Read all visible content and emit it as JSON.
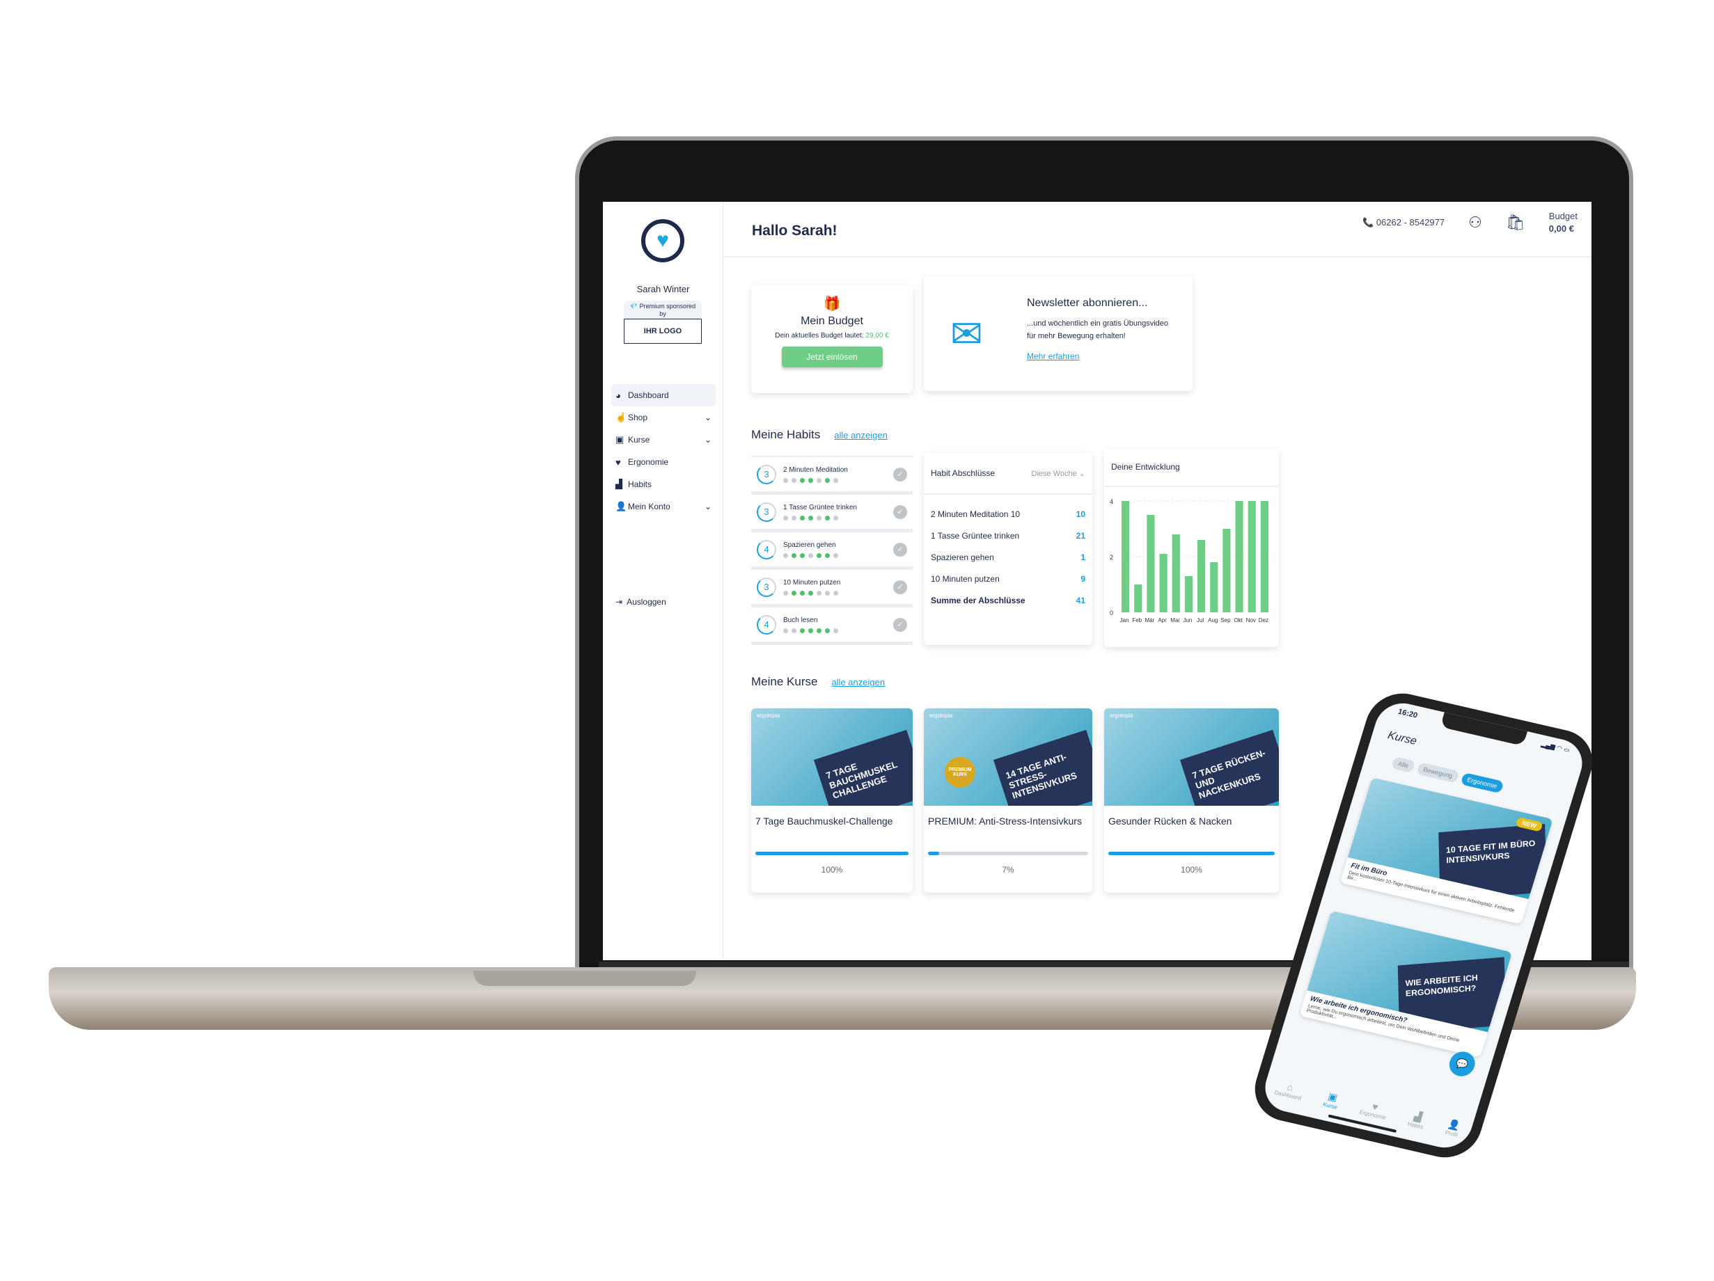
{
  "colors": {
    "accent": "#1a9ee0",
    "green": "#6fce85",
    "navy": "#1f2a4a"
  },
  "sidebar": {
    "user_name": "Sarah Winter",
    "premium": "Premium sponsored by",
    "sponsor_logo": "IHR LOGO",
    "items": [
      {
        "label": "Dashboard",
        "icon": "gauge-icon",
        "active": true,
        "expandable": false
      },
      {
        "label": "Shop",
        "icon": "cursor-click-icon",
        "expandable": true
      },
      {
        "label": "Kurse",
        "icon": "video-icon",
        "expandable": true
      },
      {
        "label": "Ergonomie",
        "icon": "heart-icon",
        "expandable": false
      },
      {
        "label": "Habits",
        "icon": "bar-chart-icon",
        "expandable": false
      },
      {
        "label": "Mein Konto",
        "icon": "user-icon",
        "expandable": true
      }
    ],
    "logout": "Ausloggen"
  },
  "header": {
    "greeting": "Hallo Sarah!",
    "phone": "06262 - 8542977",
    "budget_label": "Budget",
    "budget_value": "0,00 €"
  },
  "budget_card": {
    "title": "Mein Budget",
    "text": "Dein aktuelles Budget lautet:",
    "amount": "29,00 €",
    "button": "Jetzt einlösen"
  },
  "newsletter": {
    "title": "Newsletter abonnieren...",
    "line1": "...und wöchentlich ein gratis Übungsvideo",
    "line2": "für mehr Bewegung erhalten!",
    "link": "Mehr erfahren"
  },
  "habits": {
    "title": "Meine Habits",
    "link": "alle anzeigen",
    "items": [
      {
        "name": "2 Minuten Meditation",
        "count": "3",
        "dots": [
          0,
          0,
          1,
          1,
          0,
          1,
          0
        ]
      },
      {
        "name": "1 Tasse Grüntee trinken",
        "count": "3",
        "dots": [
          0,
          0,
          1,
          1,
          0,
          1,
          0
        ]
      },
      {
        "name": "Spazieren gehen",
        "count": "4",
        "dots": [
          0,
          1,
          1,
          0,
          1,
          1,
          0
        ]
      },
      {
        "name": "10 Minuten putzen",
        "count": "3",
        "dots": [
          0,
          1,
          1,
          1,
          0,
          0,
          0
        ]
      },
      {
        "name": "Buch lesen",
        "count": "4",
        "dots": [
          0,
          0,
          1,
          1,
          1,
          1,
          0
        ]
      }
    ]
  },
  "completions": {
    "title": "Habit Abschlüsse",
    "period": "Diese Woche",
    "rows": [
      {
        "label": "2 Minuten Meditation 10",
        "value": "10"
      },
      {
        "label": "1 Tasse Grüntee trinken",
        "value": "21"
      },
      {
        "label": "Spazieren gehen",
        "value": "1"
      },
      {
        "label": "10 Minuten putzen",
        "value": "9"
      }
    ],
    "total_label": "Summe der Abschlüsse",
    "total_value": "41"
  },
  "chart_data": {
    "type": "bar",
    "title": "Deine Entwicklung",
    "categories": [
      "Jan",
      "Feb",
      "Mär",
      "Apr",
      "Mai",
      "Jun",
      "Jul",
      "Aug",
      "Sep",
      "Okt",
      "Nov",
      "Dez"
    ],
    "values": [
      4,
      1,
      3.5,
      2.1,
      2.8,
      1.3,
      2.6,
      1.8,
      3,
      4,
      4,
      4
    ],
    "yticks": [
      "0",
      "2",
      "4"
    ],
    "ylim": [
      0,
      4
    ],
    "grid": true,
    "color": "#6fce85"
  },
  "courses": {
    "title": "Meine Kurse",
    "link": "alle anzeigen",
    "items": [
      {
        "banner": "7 TAGE BAUCHMUSKEL CHALLENGE",
        "title": "7 Tage Bauchmuskel-Challenge",
        "progress": 100,
        "progress_label": "100%"
      },
      {
        "banner": "14 TAGE ANTI-STRESS-INTENSIVKURS",
        "badge": "PREMIUM KURS",
        "title": "PREMIUM: Anti-Stress-Intensivkurs",
        "progress": 7,
        "progress_label": "7%"
      },
      {
        "banner": "7 TAGE RÜCKEN- UND NACKENKURS",
        "title": "Gesunder Rücken & Nacken",
        "progress": 100,
        "progress_label": "100%"
      }
    ],
    "brand": "ergotopia"
  },
  "phone": {
    "time": "16:20",
    "title": "Kurse",
    "chips": [
      {
        "label": "Alle"
      },
      {
        "label": "Bewegung"
      },
      {
        "label": "Ergonomie",
        "active": true
      }
    ],
    "cards": [
      {
        "banner": "10 TAGE FIT IM BÜRO INTENSIVKURS",
        "badge": "NEW",
        "title": "Fit im Büro",
        "desc": "Dein kostenloser 10-Tage-Intensivkurs für einen aktiven Arbeitsplatz. Fehlende Be..."
      },
      {
        "banner": "WIE ARBEITE ICH ERGONOMISCH?",
        "title": "Wie arbeite ich ergonomisch?",
        "desc": "Lerne, wie Du ergonomisch arbeitest, um Dein Wohlbefinden und Deine Produktivität..."
      }
    ],
    "tabs": [
      {
        "label": "Dashboard",
        "icon": "home-icon"
      },
      {
        "label": "Kurse",
        "icon": "video-icon",
        "active": true
      },
      {
        "label": "Ergonomie",
        "icon": "heart-icon"
      },
      {
        "label": "Habits",
        "icon": "bar-chart-icon"
      },
      {
        "label": "Profil",
        "icon": "user-icon"
      }
    ]
  }
}
